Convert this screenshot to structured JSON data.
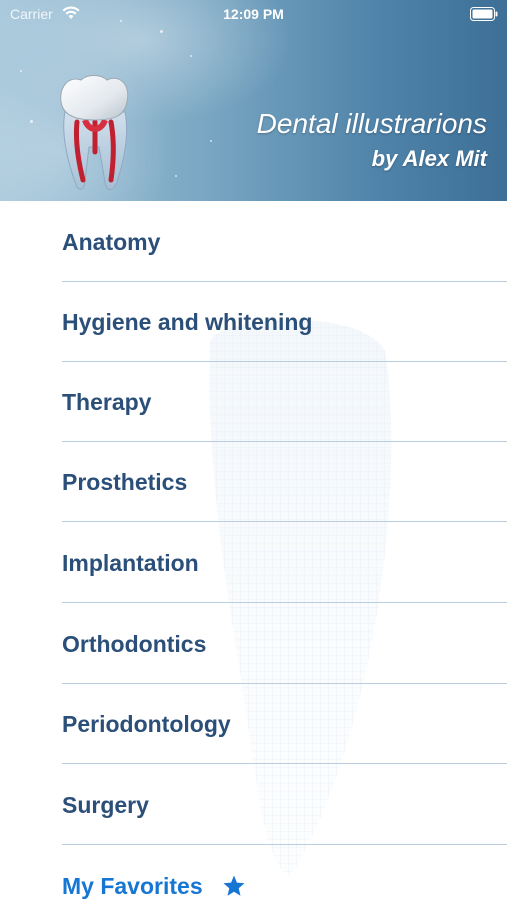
{
  "status_bar": {
    "carrier": "Carrier",
    "time": "12:09 PM"
  },
  "header": {
    "title": "Dental illustrarions",
    "subtitle": "by Alex Mit",
    "logo_icon": "tooth-icon"
  },
  "menu": {
    "items": [
      {
        "label": "Anatomy"
      },
      {
        "label": "Hygiene and whitening"
      },
      {
        "label": "Therapy"
      },
      {
        "label": "Prosthetics"
      },
      {
        "label": "Implantation"
      },
      {
        "label": "Orthodontics"
      },
      {
        "label": "Periodontology"
      },
      {
        "label": "Surgery"
      }
    ],
    "favorites": {
      "label": "My Favorites",
      "icon": "star-icon"
    }
  },
  "colors": {
    "menu_text": "#2b4f78",
    "favorites_text": "#1576d4",
    "divider": "#b9cde0",
    "header_dark": "#3d6f97"
  }
}
